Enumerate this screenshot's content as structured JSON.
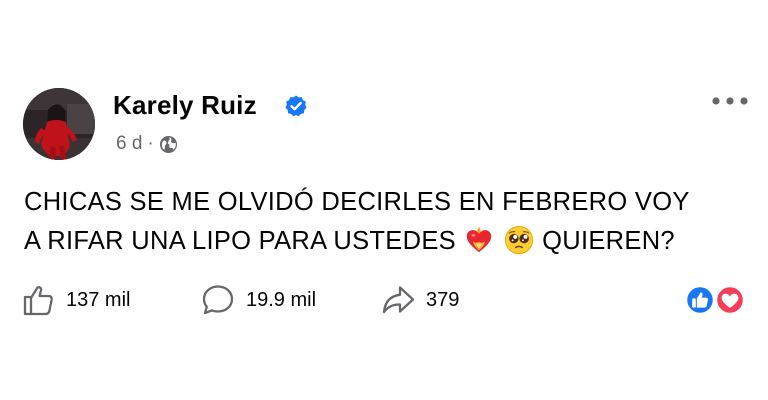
{
  "post": {
    "author": "Karely Ruiz",
    "verified": true,
    "time": "6 d",
    "separator": "·",
    "audience_icon": "globe-icon",
    "text_line1": "CHICAS SE ME OLVIDÓ DECIRLES EN FEBRERO VOY",
    "text_line2_before": "A RIFAR UNA LIPO PARA USTEDES",
    "text_line2_after": "QUIEREN?",
    "emojis": [
      "heart-on-fire-emoji",
      "pleading-face-emoji"
    ],
    "more_icon": "more-options-icon"
  },
  "actions": {
    "likes": "137 mil",
    "comments": "19.9 mil",
    "shares": "379"
  },
  "reactions": [
    "like-reaction-icon",
    "love-reaction-icon"
  ],
  "colors": {
    "verified": "#1877f2",
    "like_reaction": "#1877f2",
    "love_reaction": "#f33e58",
    "secondary_text": "#65676b",
    "primary_text": "#050505"
  }
}
